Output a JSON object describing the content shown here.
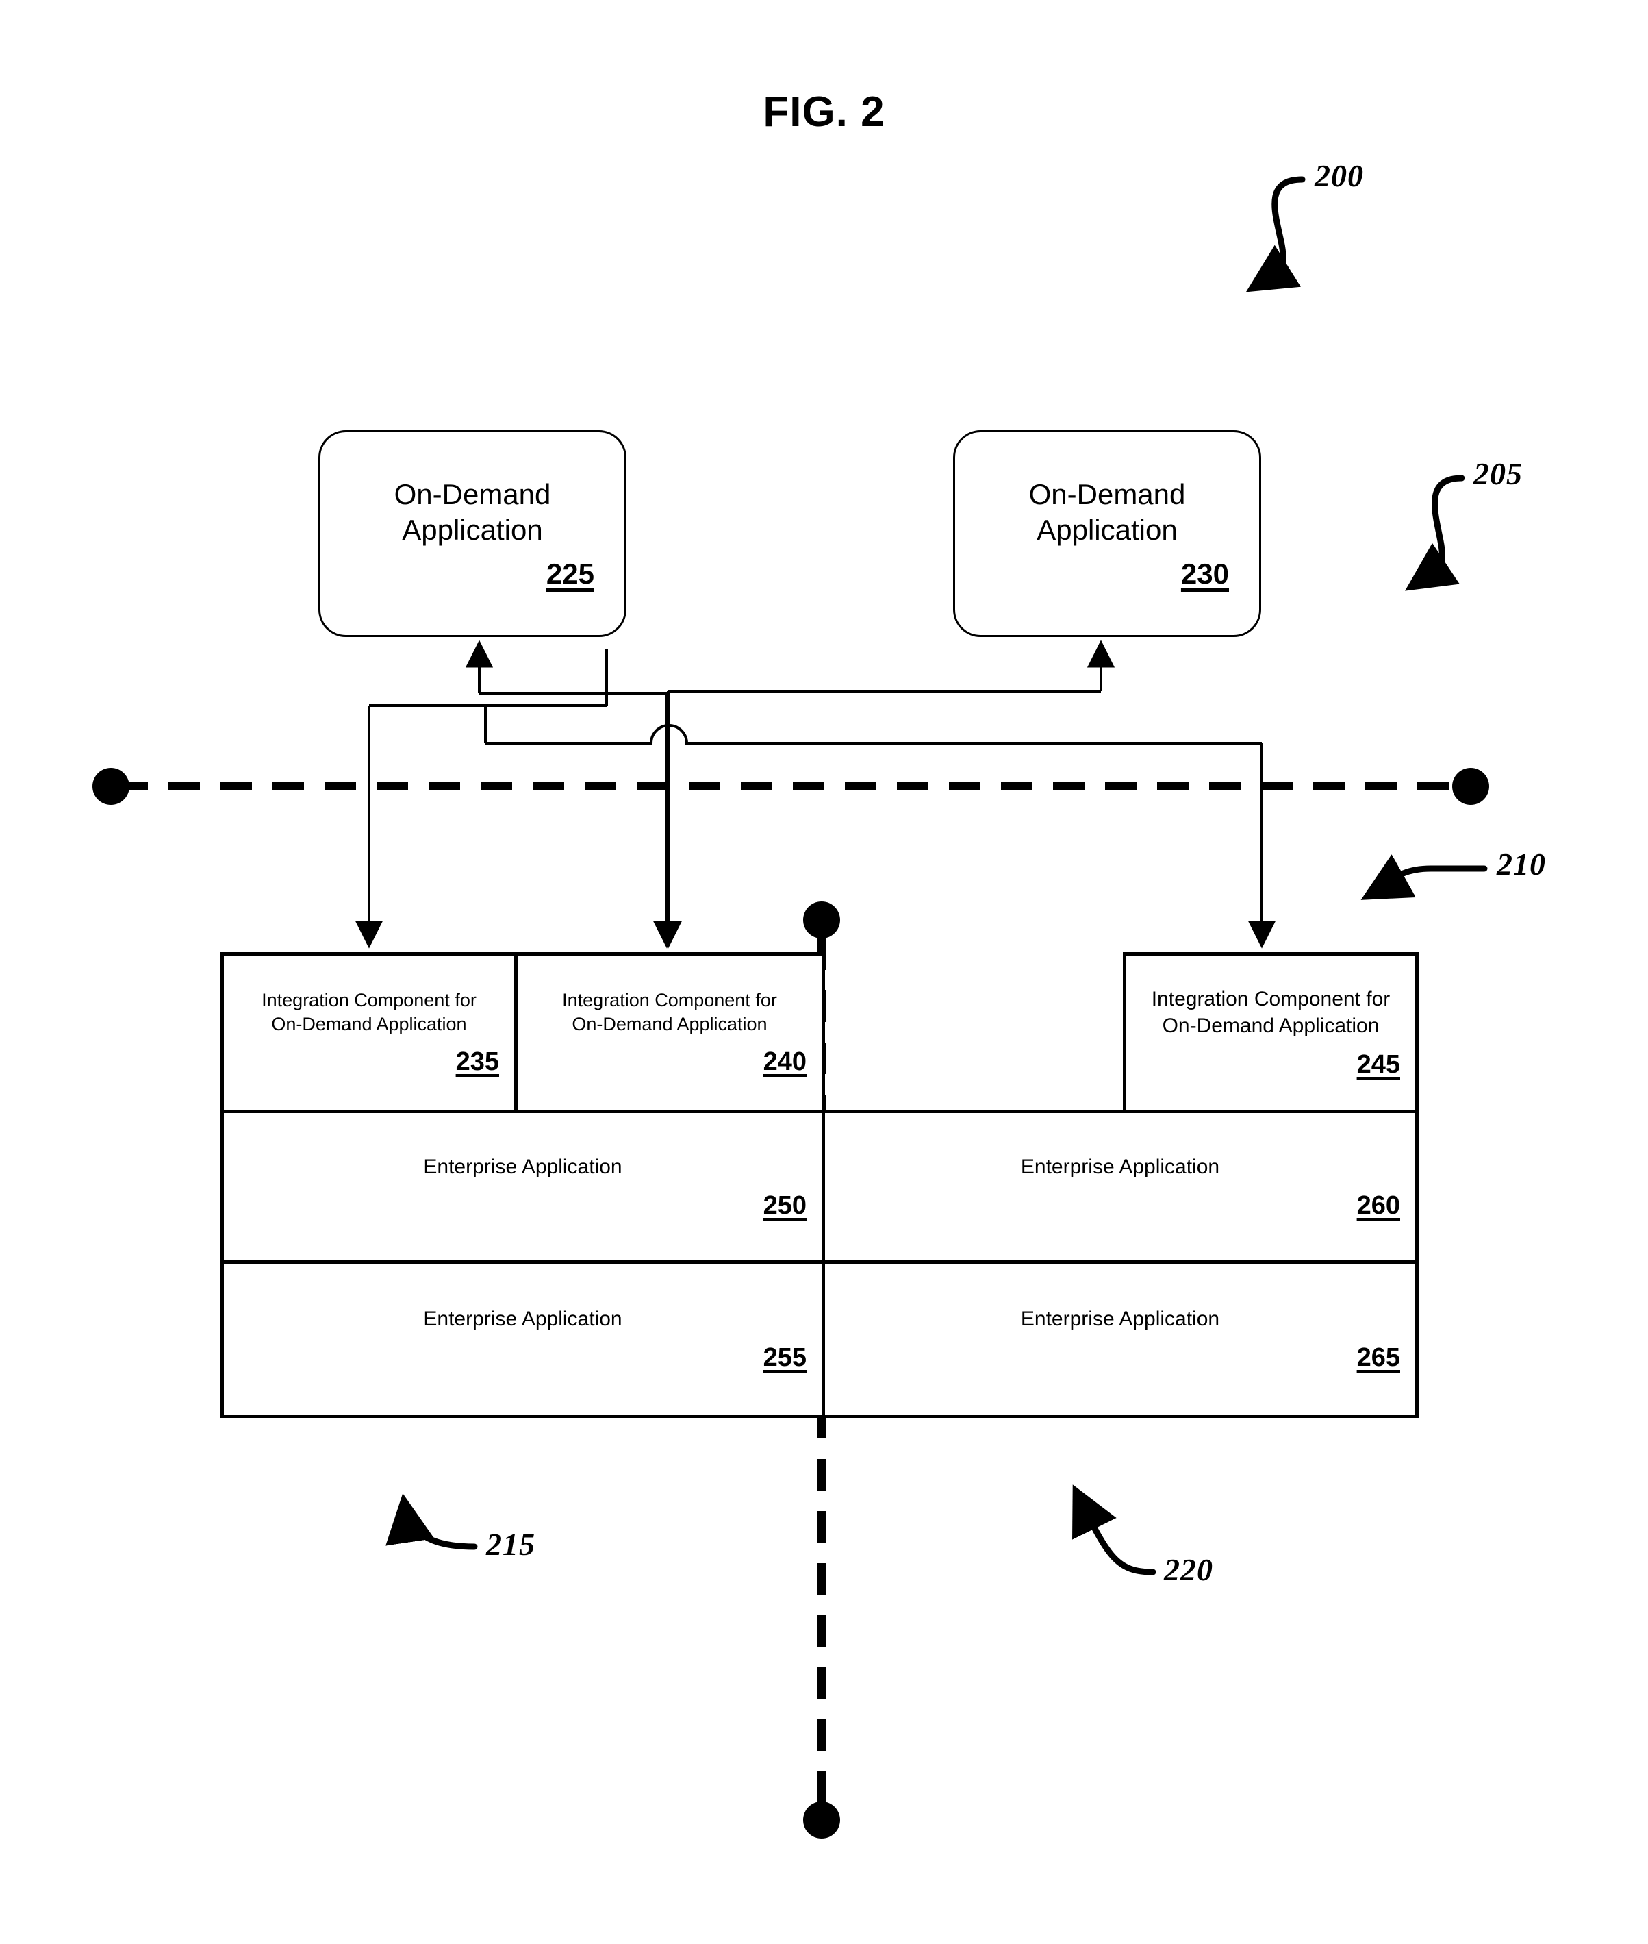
{
  "figure": {
    "title": "FIG. 2"
  },
  "on_demand_boxes": [
    {
      "id": "box-225",
      "title": "On-Demand\nApplication",
      "ref": "225"
    },
    {
      "id": "box-230",
      "title": "On-Demand\nApplication",
      "ref": "230"
    }
  ],
  "integration_components": [
    {
      "id": "box-235",
      "title": "Integration Component for\nOn-Demand Application",
      "ref": "235"
    },
    {
      "id": "box-240",
      "title": "Integration Component for\nOn-Demand Application",
      "ref": "240"
    },
    {
      "id": "box-245",
      "title": "Integration Component for\nOn-Demand Application",
      "ref": "245"
    }
  ],
  "enterprise_applications": [
    {
      "id": "box-250",
      "title": "Enterprise Application",
      "ref": "250"
    },
    {
      "id": "box-260",
      "title": "Enterprise Application",
      "ref": "260"
    },
    {
      "id": "box-255",
      "title": "Enterprise Application",
      "ref": "255"
    },
    {
      "id": "box-265",
      "title": "Enterprise Application",
      "ref": "265"
    }
  ],
  "reference_numerals": [
    {
      "id": "ref-200",
      "label": "200"
    },
    {
      "id": "ref-205",
      "label": "205"
    },
    {
      "id": "ref-210",
      "label": "210"
    },
    {
      "id": "ref-215",
      "label": "215"
    },
    {
      "id": "ref-220",
      "label": "220"
    }
  ],
  "colors": {
    "line": "#000000",
    "background": "#ffffff"
  }
}
